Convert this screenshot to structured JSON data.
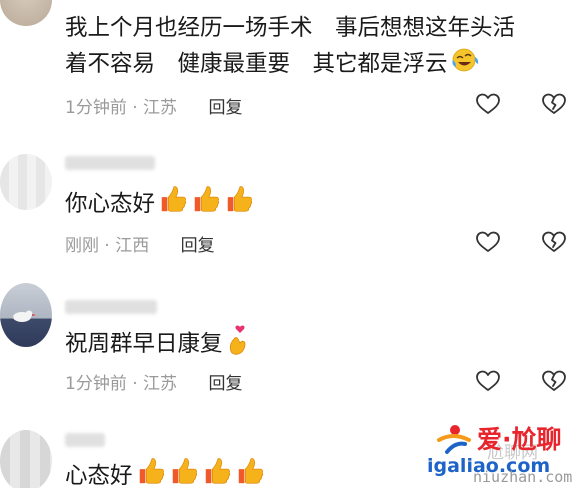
{
  "comments": [
    {
      "text_line1": "我上个月也经历一场手术　事后想想这年头活",
      "text_line2": "着不容易　健康最重要　其它都是浮云",
      "time": "1分钟前",
      "location": "江苏",
      "reply_label": "回复",
      "emoji": "laughing-tears-emoji"
    },
    {
      "text": "你心态好",
      "time": "刚刚",
      "location": "江西",
      "reply_label": "回复",
      "emoji": "thumbs-up-emoji"
    },
    {
      "text": "祝周群早日康复",
      "time": "1分钟前",
      "location": "江苏",
      "reply_label": "回复",
      "emoji": "finger-heart-emoji"
    },
    {
      "text": "心态好",
      "emoji": "thumbs-up-emoji"
    }
  ],
  "meta_separator": "·",
  "watermark": {
    "brand": "爱·尬聊",
    "url": "igaliao.com",
    "site_name": "尬聊网",
    "domain": "niuzhan.com"
  },
  "colors": {
    "text": "#1a1a1a",
    "meta": "#9a9a9a",
    "emoji_yellow": "#f6b21b",
    "brand_red": "#e8242c",
    "brand_blue": "#1e63c7"
  }
}
